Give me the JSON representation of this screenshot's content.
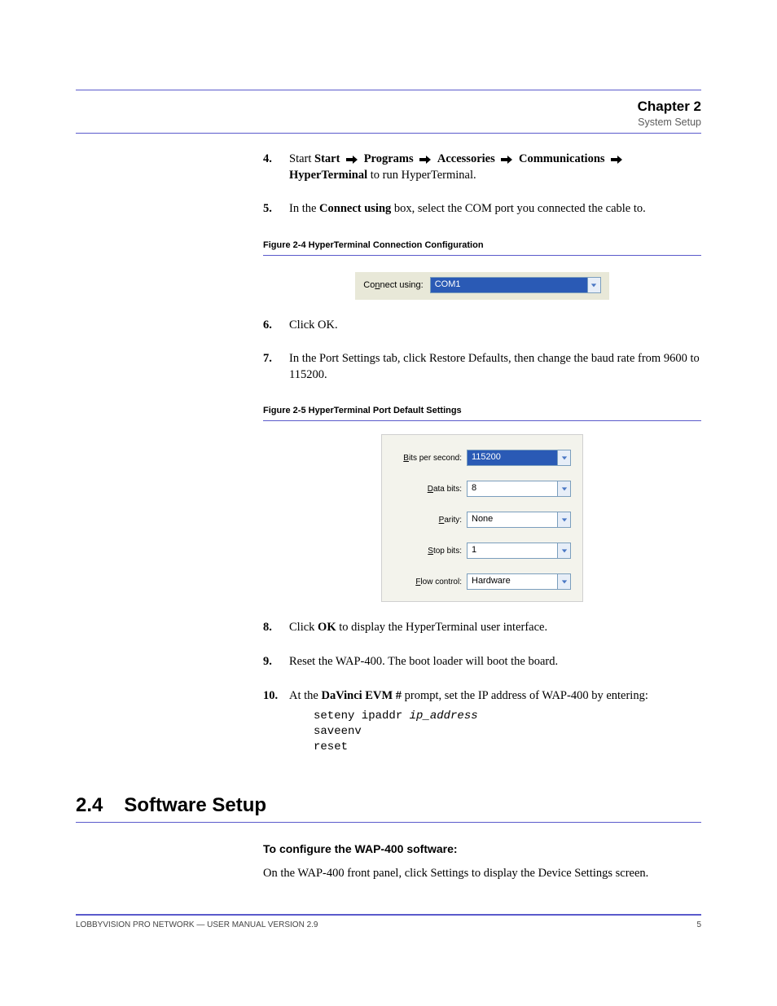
{
  "chapter": {
    "number": "Chapter 2",
    "title": "System Setup"
  },
  "steps": {
    "s4": {
      "num": "4.",
      "text_a": "Start ",
      "b1": "Start ",
      "pre_arrow": "",
      "b2": "Programs ",
      "b3": "Accessories ",
      "b4": "Communications",
      "b5": "HyperTerminal",
      "tail": " to run HyperTerminal."
    },
    "s5": {
      "num": "5.",
      "text_a": "In the ",
      "b1": "Connect using",
      "text_b": " box, select the COM port you connected the cable to."
    },
    "s6": {
      "num": "6.",
      "text": "Click OK."
    },
    "s7": {
      "num": "7.",
      "text": "In the Port Settings tab, click Restore Defaults, then change the baud rate from 9600 to 115200."
    },
    "s8": {
      "num": "8.",
      "text_a": "Click ",
      "b1": "OK",
      "text_b": " to display the HyperTerminal user interface."
    },
    "s9": {
      "num": "9.",
      "text": "Reset the WAP-400. The boot loader will boot the board."
    },
    "s10": {
      "num": "10.",
      "text_a": "At the ",
      "b1": "DaVinci EVM #",
      "text_b": " prompt, set the IP address of WAP-400 by entering:",
      "cmd1_a": "seteny ipaddr ",
      "cmd1_i": "ip_address",
      "cmd2": "saveenv",
      "cmd3": "reset"
    }
  },
  "figures": {
    "f24": {
      "caption": "Figure 2-4  HyperTerminal Connection Configuration",
      "connect_label_pre": "Co",
      "connect_label_u": "n",
      "connect_label_post": "nect using:",
      "connect_value": "COM1"
    },
    "f25": {
      "caption": "Figure 2-5  HyperTerminal Port Default Settings",
      "rows": {
        "bits": {
          "label_u": "B",
          "label_post": "its per second:",
          "value": "115200",
          "selected": true
        },
        "data": {
          "label_u": "D",
          "label_post": "ata bits:",
          "value": "8",
          "selected": false
        },
        "parity": {
          "label_u": "P",
          "label_post": "arity:",
          "value": "None",
          "selected": false
        },
        "stop": {
          "label_u": "S",
          "label_post": "top bits:",
          "value": "1",
          "selected": false
        },
        "flow": {
          "label_u": "F",
          "label_post": "low control:",
          "value": "Hardware",
          "selected": false
        }
      }
    }
  },
  "section": {
    "num": "2.4",
    "title": "Software Setup",
    "subtitle": "To configure the WAP-400 software:",
    "body": "On the WAP-400 front panel, click Settings to display the Device Settings screen."
  },
  "footer": {
    "left": "LOBBYVISION PRO NETWORK — USER MANUAL VERSION 2.9",
    "right": "5"
  }
}
